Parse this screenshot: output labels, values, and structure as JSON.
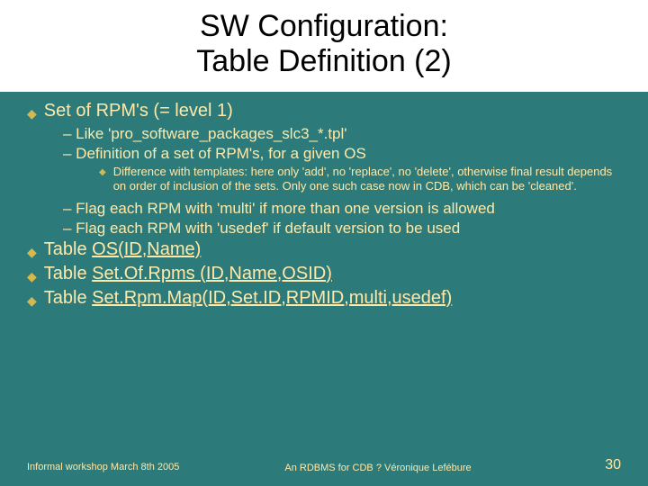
{
  "title": {
    "line1": "SW Configuration:",
    "line2": "Table Definition (2)"
  },
  "bullets": {
    "b1": "Set of RPM's (= level 1)",
    "b1a": "– Like 'pro_software_packages_slc3_*.tpl'",
    "b1b": "– Definition of a set of RPM's, for a given OS",
    "b1b1": "Difference with templates: here only 'add', no 'replace', no 'delete', otherwise final result depends on order of inclusion of the sets. Only one such case now in CDB, which can be 'cleaned'.",
    "b1c": "– Flag each RPM with 'multi' if more than one version is allowed",
    "b1d": "– Flag each RPM with 'usedef' if default version to be used",
    "b2a": "Table ",
    "b2b": "OS(ID,Name)",
    "b3a": "Table ",
    "b3b": "Set.Of.Rpms (ID,Name,OSID)",
    "b4a": "Table ",
    "b4b": "Set.Rpm.Map(ID,Set.ID,RPMID,multi,usedef)"
  },
  "footer": {
    "left": "Informal workshop March 8th 2005",
    "center": "An RDBMS for CDB ? Véronique Lefébure",
    "page": "30"
  }
}
